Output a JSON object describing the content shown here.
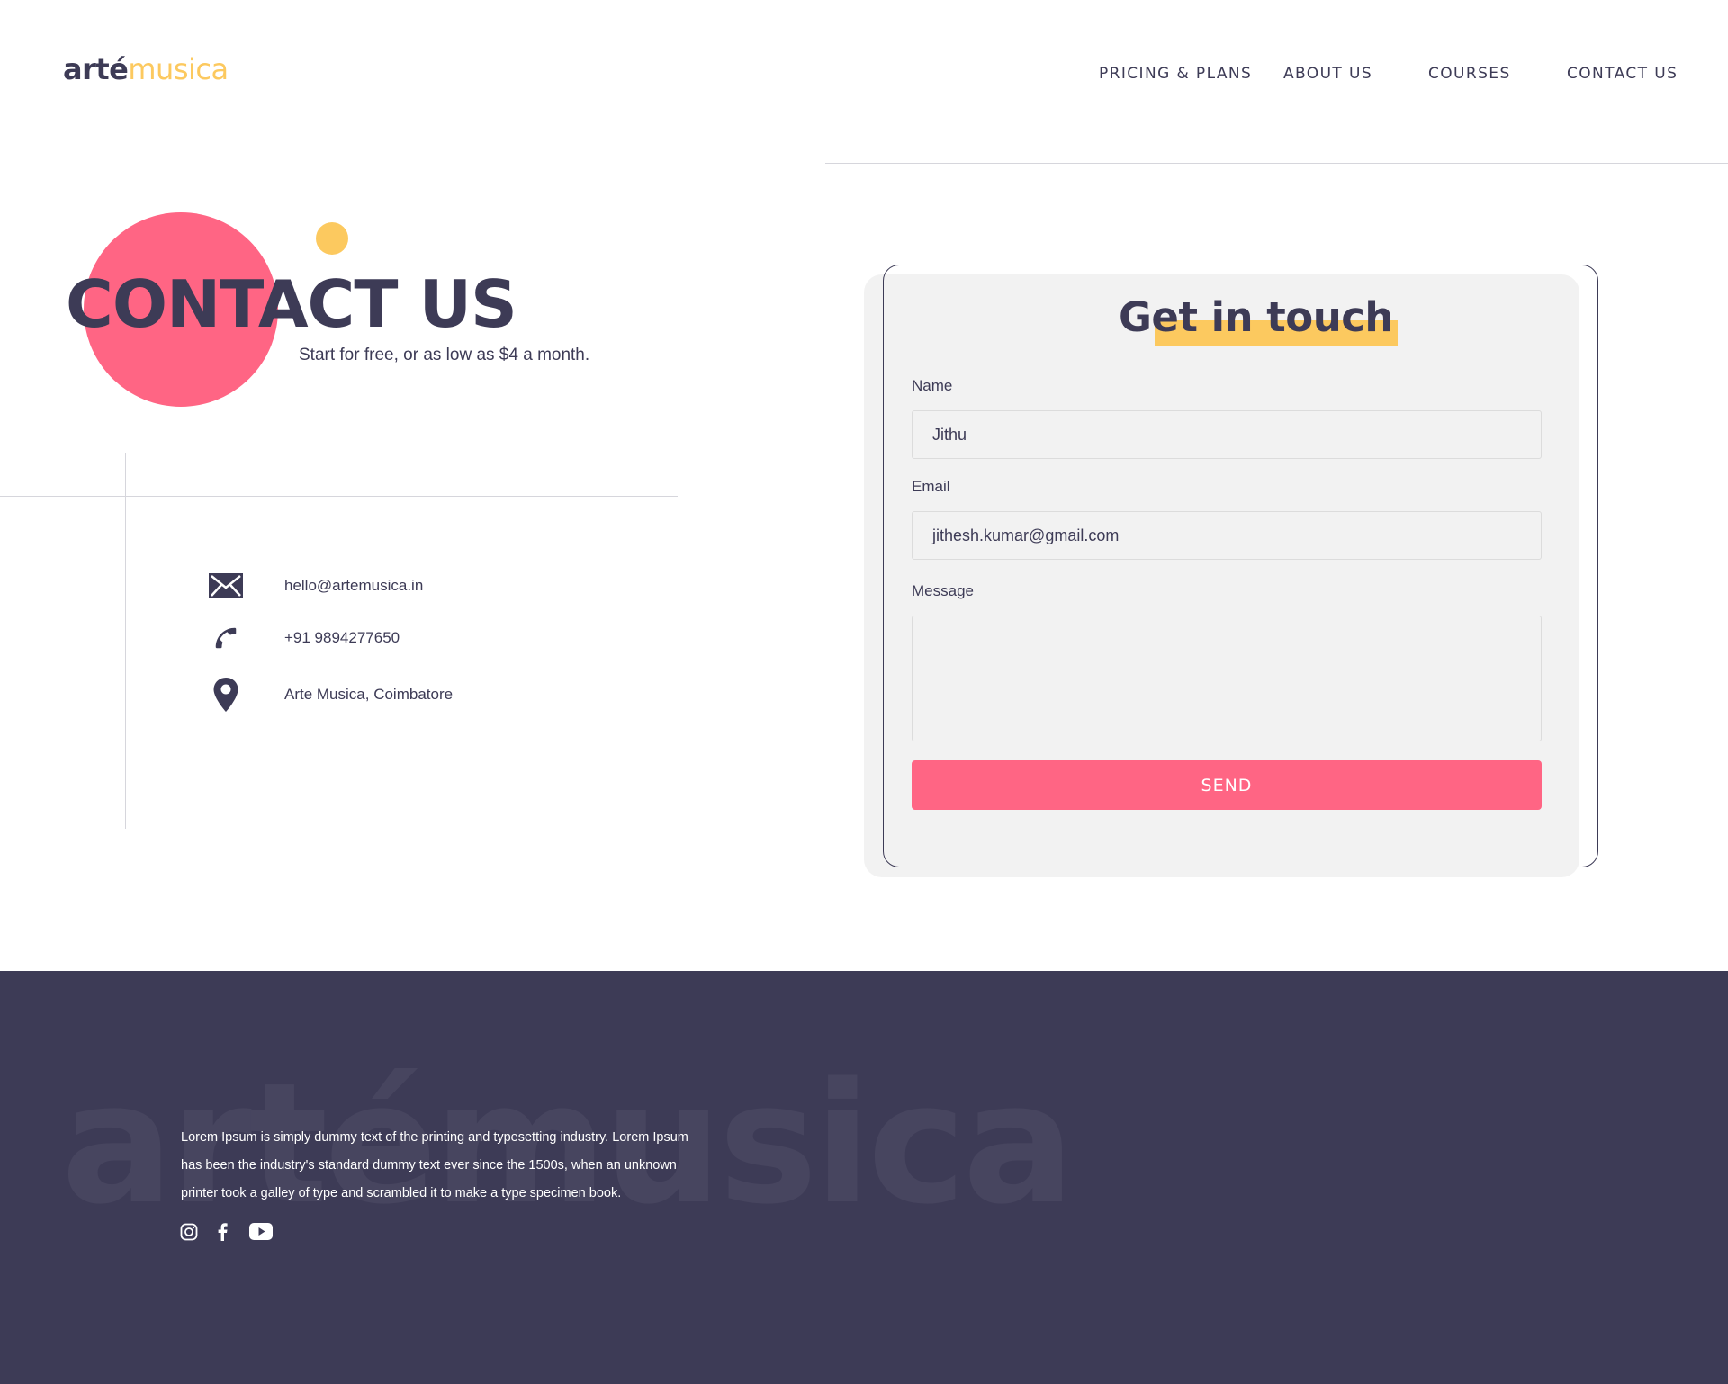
{
  "header": {
    "logo_part1": "arté",
    "logo_part2": "musica",
    "nav": [
      "PRICING & PLANS",
      "ABOUT US",
      "COURSES",
      "CONTACT US"
    ]
  },
  "hero": {
    "title": "CONTACT US",
    "subtitle": "Start for free, or as low as $4 a month."
  },
  "contact": {
    "email": "hello@artemusica.in",
    "phone": "+91 9894277650",
    "location": "Arte Musica, Coimbatore"
  },
  "form": {
    "title": "Get in touch",
    "name_label": "Name",
    "name_value": "Jithu",
    "email_label": "Email",
    "email_value": "jithesh.kumar@gmail.com",
    "message_label": "Message",
    "message_value": "",
    "send_label": "SEND"
  },
  "footer": {
    "watermark": "artémusica",
    "text": "Lorem Ipsum is simply dummy text of the printing and typesetting industry. Lorem Ipsum has been the industry's standard dummy text ever since the 1500s, when an unknown printer took a galley of type and scrambled it to make a type specimen book.",
    "social_icons": [
      "instagram-icon",
      "facebook-icon",
      "youtube-icon"
    ]
  },
  "colors": {
    "primary": "#3d3b56",
    "accent_pink": "#ff6584",
    "accent_yellow": "#fcc95f",
    "input_bg": "#f2f2f2"
  }
}
